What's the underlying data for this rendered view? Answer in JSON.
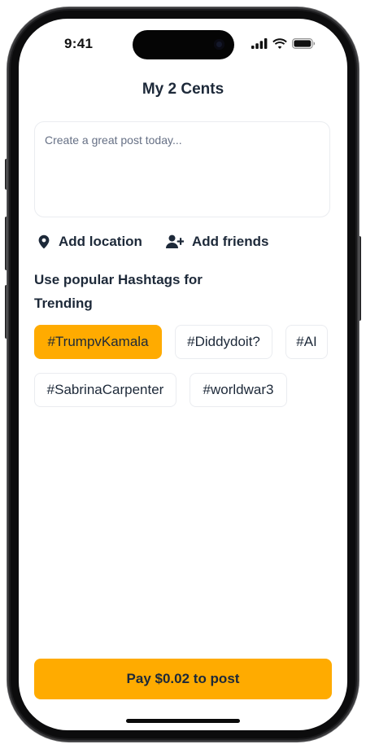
{
  "status_bar": {
    "time": "9:41",
    "icons": [
      "signal-icon",
      "wifi-icon",
      "battery-icon"
    ]
  },
  "header": {
    "title": "My 2 Cents"
  },
  "composer": {
    "placeholder": "Create a great post today..."
  },
  "actions": {
    "location_label": "Add location",
    "location_icon": "location-pin-icon",
    "friends_label": "Add friends",
    "friends_icon": "add-user-icon"
  },
  "hashtags": {
    "heading_line1": "Use popular Hashtags for",
    "heading_line2": "Trending",
    "selected": "#TrumpvKamala",
    "items": [
      {
        "label": "#TrumpvKamala",
        "selected": true
      },
      {
        "label": "#Diddydoit?",
        "selected": false
      },
      {
        "label": "#AI",
        "selected": false
      },
      {
        "label": "#SabrinaCarpenter",
        "selected": false
      },
      {
        "label": "#worldwar3",
        "selected": false
      }
    ]
  },
  "footer": {
    "pay_label": "Pay $0.02 to post"
  },
  "colors": {
    "accent": "#ffab00",
    "text": "#1d2939",
    "border": "#eaecf0",
    "placeholder": "#667085"
  }
}
